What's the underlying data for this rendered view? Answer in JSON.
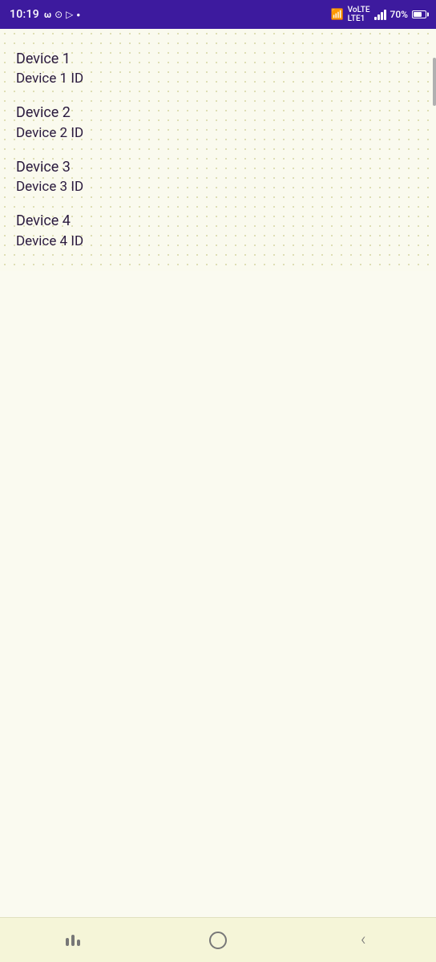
{
  "statusBar": {
    "time": "10:19",
    "battery": "70%",
    "signal": "LTE1"
  },
  "devices": [
    {
      "name": "Device 1",
      "id": "Device 1 ID"
    },
    {
      "name": "Device 2",
      "id": "Device 2 ID"
    },
    {
      "name": "Device 3",
      "id": "Device 3 ID"
    },
    {
      "name": "Device 4",
      "id": "Device 4 ID"
    }
  ],
  "navBar": {
    "recentsSrLabel": "Recents",
    "homeSrLabel": "Home",
    "backSrLabel": "Back"
  }
}
